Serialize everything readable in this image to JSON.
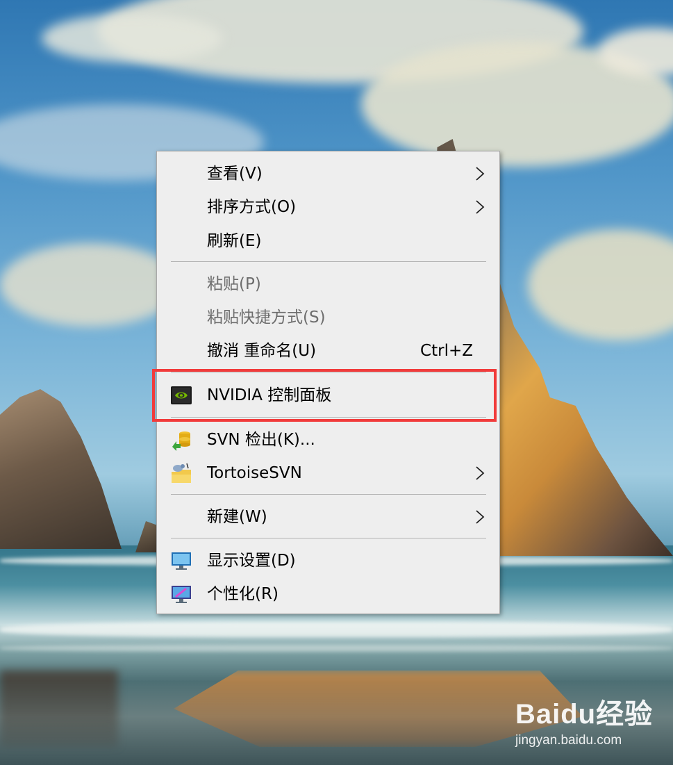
{
  "menu": {
    "items": [
      {
        "label": "查看(V)",
        "submenu": true
      },
      {
        "label": "排序方式(O)",
        "submenu": true
      },
      {
        "label": "刷新(E)"
      },
      {
        "label": "粘贴(P)",
        "disabled": true
      },
      {
        "label": "粘贴快捷方式(S)",
        "disabled": true
      },
      {
        "label": "撤消 重命名(U)",
        "shortcut": "Ctrl+Z"
      },
      {
        "label": "NVIDIA 控制面板",
        "icon": "nvidia-icon",
        "highlighted": true
      },
      {
        "label": "SVN 检出(K)...",
        "icon": "svn-checkout-icon"
      },
      {
        "label": "TortoiseSVN",
        "icon": "tortoisesvn-icon",
        "submenu": true
      },
      {
        "label": "新建(W)",
        "submenu": true
      },
      {
        "label": "显示设置(D)",
        "icon": "display-settings-icon"
      },
      {
        "label": "个性化(R)",
        "icon": "personalize-icon"
      }
    ]
  },
  "highlight_color": "#f13b3b",
  "watermark": {
    "brand": "Baidu经验",
    "url": "jingyan.baidu.com"
  }
}
